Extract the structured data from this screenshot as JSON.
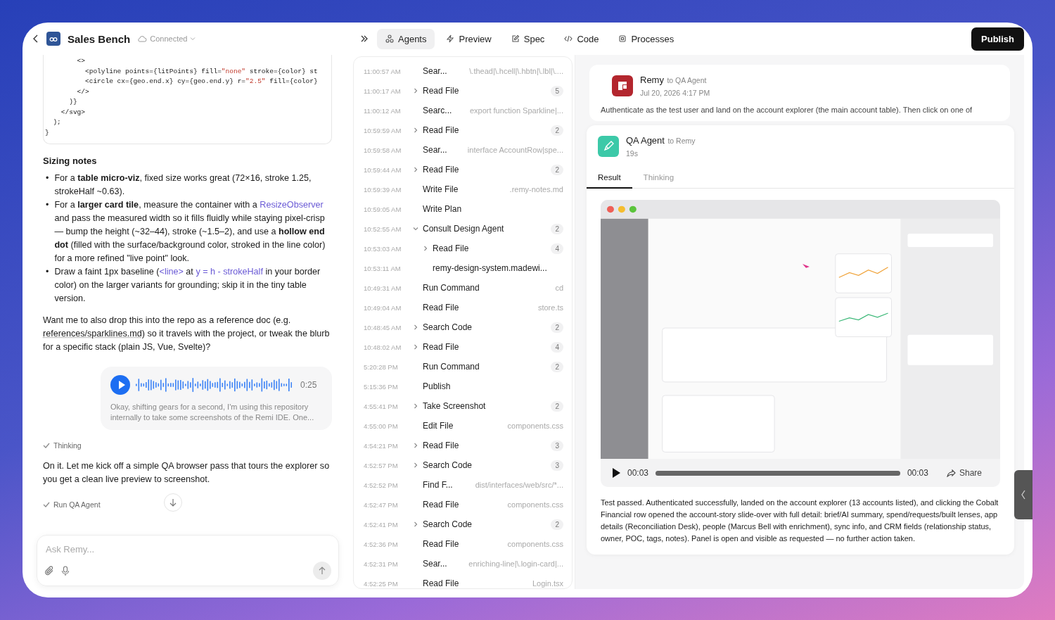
{
  "header": {
    "title": "Sales Bench",
    "status": "Connected"
  },
  "tabs": [
    {
      "label": "Agents",
      "kind": "agents",
      "selected": true
    },
    {
      "label": "Preview",
      "kind": "preview",
      "selected": false
    },
    {
      "label": "Spec",
      "kind": "spec",
      "selected": false
    },
    {
      "label": "Code",
      "kind": "code",
      "selected": false
    },
    {
      "label": "Processes",
      "kind": "processes",
      "selected": false
    }
  ],
  "publish_button": "Publish",
  "chat": {
    "code_lines": [
      [
        {
          "text": "        <>",
          "kind": "plain"
        }
      ],
      [
        {
          "text": "          <polyline points={litPoints} fill=",
          "kind": "plain"
        },
        {
          "text": "\"none\"",
          "kind": "string"
        },
        {
          "text": " stroke={color} st",
          "kind": "plain"
        }
      ],
      [
        {
          "text": "          <circle cx={geo.end.x} cy={geo.end.y} r=",
          "kind": "plain"
        },
        {
          "text": "\"2.5\"",
          "kind": "string"
        },
        {
          "text": " fill={color}",
          "kind": "plain"
        }
      ],
      [
        {
          "text": "        </>",
          "kind": "plain"
        }
      ],
      [
        {
          "text": "      )}",
          "kind": "plain"
        }
      ],
      [
        {
          "text": "    </svg>",
          "kind": "plain"
        }
      ],
      [
        {
          "text": "  );",
          "kind": "plain"
        }
      ],
      [
        {
          "text": "}",
          "kind": "plain"
        }
      ]
    ],
    "heading": "Sizing notes",
    "bullets": [
      {
        "marker": "•",
        "segments": [
          {
            "text": "For a ",
            "kind": "text"
          },
          {
            "text": "table micro-viz",
            "kind": "bold"
          },
          {
            "text": ", fixed size works great (72×16, stroke 1.25, strokeHalf ~0.63).",
            "kind": "text"
          }
        ]
      },
      {
        "marker": "•",
        "segments": [
          {
            "text": "For a ",
            "kind": "text"
          },
          {
            "text": "larger card tile",
            "kind": "bold"
          },
          {
            "text": ", measure the container with a ",
            "kind": "text"
          },
          {
            "text": "ResizeObserver",
            "kind": "code"
          },
          {
            "text": " and pass the measured width so it fills fluidly while staying pixel-crisp — bump the height (~32–44), stroke (~1.5–2), and use a ",
            "kind": "text"
          },
          {
            "text": "hollow end dot",
            "kind": "bold"
          },
          {
            "text": " (filled with the surface/background color, stroked in the line color) for a more refined \"live point\" look.",
            "kind": "text"
          }
        ]
      },
      {
        "marker": "•",
        "segments": [
          {
            "text": "Draw a faint 1px baseline (",
            "kind": "text"
          },
          {
            "text": "<line>",
            "kind": "code"
          },
          {
            "text": " at ",
            "kind": "text"
          },
          {
            "text": "y = h - strokeHalf",
            "kind": "code"
          },
          {
            "text": " in your border color) on the larger variants for grounding; skip it in the tiny table version.",
            "kind": "text"
          }
        ]
      }
    ],
    "question": [
      {
        "text": "Want me to also drop this into the repo as a reference doc (e.g. ",
        "kind": "text"
      },
      {
        "text": "references/sparklines.md",
        "kind": "link"
      },
      {
        "text": ") so it travels with the project, or tweak the blurb for a specific stack (plain JS, Vue, Svelte)?",
        "kind": "text"
      }
    ],
    "voice_note": {
      "duration": "0:25",
      "transcript": "Okay, shifting gears for a second, I'm using this repository internally to take some screenshots of the Remi IDE. One..."
    },
    "thinking_step": {
      "label": "Thinking",
      "done": true
    },
    "reply": "On it. Let me kick off a simple QA browser pass that tours the explorer so you get a clean live preview to screenshot.",
    "run_step": {
      "label": "Run QA Agent",
      "done": true
    },
    "composer": {
      "placeholder": "Ask Remy..."
    }
  },
  "activity": [
    {
      "time": "11:00:57 AM",
      "label": "Sear...",
      "detail": "\\.thead|\\.hcell|\\.hbtn|\\.lbl|\\....",
      "kind": "plain"
    },
    {
      "time": "11:00:17 AM",
      "label": "Read File",
      "count": "5",
      "kind": "expandable",
      "expanded": false
    },
    {
      "time": "11:00:12 AM",
      "label": "Searc...",
      "detail": "export function Sparkline|...",
      "kind": "plain"
    },
    {
      "time": "10:59:59 AM",
      "label": "Read File",
      "count": "2",
      "kind": "expandable",
      "expanded": false
    },
    {
      "time": "10:59:58 AM",
      "label": "Sear...",
      "detail": "interface AccountRow|spe...",
      "kind": "plain"
    },
    {
      "time": "10:59:44 AM",
      "label": "Read File",
      "count": "2",
      "kind": "expandable",
      "expanded": false
    },
    {
      "time": "10:59:39 AM",
      "label": "Write File",
      "detail": ".remy-notes.md",
      "kind": "plain"
    },
    {
      "time": "10:59:05 AM",
      "label": "Write Plan",
      "kind": "plain"
    },
    {
      "time": "10:52:55 AM",
      "label": "Consult Design Agent",
      "count": "2",
      "kind": "expandable",
      "expanded": true,
      "children": [
        {
          "time": "10:53:03 AM",
          "label": "Read File",
          "count": "4",
          "kind": "expandable",
          "expanded": false
        },
        {
          "time": "10:53:11 AM",
          "label": "remy-design-system.madewi...",
          "kind": "plain"
        }
      ]
    },
    {
      "time": "10:49:31 AM",
      "label": "Run Command",
      "detail": "cd",
      "kind": "plain"
    },
    {
      "time": "10:49:04 AM",
      "label": "Read File",
      "detail": "store.ts",
      "kind": "plain"
    },
    {
      "time": "10:48:45 AM",
      "label": "Search Code",
      "count": "2",
      "kind": "expandable",
      "expanded": false
    },
    {
      "time": "10:48:02 AM",
      "label": "Read File",
      "count": "4",
      "kind": "expandable",
      "expanded": false
    },
    {
      "time": "5:20:28 PM",
      "label": "Run Command",
      "count": "2",
      "kind": "plain"
    },
    {
      "time": "5:15:36 PM",
      "label": "Publish",
      "kind": "plain"
    },
    {
      "time": "4:55:41 PM",
      "label": "Take Screenshot",
      "count": "2",
      "kind": "expandable",
      "expanded": false
    },
    {
      "time": "4:55:00 PM",
      "label": "Edit File",
      "detail": "components.css",
      "kind": "plain"
    },
    {
      "time": "4:54:21 PM",
      "label": "Read File",
      "count": "3",
      "kind": "expandable",
      "expanded": false
    },
    {
      "time": "4:52:57 PM",
      "label": "Search Code",
      "count": "3",
      "kind": "expandable",
      "expanded": false
    },
    {
      "time": "4:52:52 PM",
      "label": "Find F...",
      "detail": "dist/interfaces/web/src/*...",
      "kind": "plain"
    },
    {
      "time": "4:52:47 PM",
      "label": "Read File",
      "detail": "components.css",
      "kind": "plain"
    },
    {
      "time": "4:52:41 PM",
      "label": "Search Code",
      "count": "2",
      "kind": "expandable",
      "expanded": false
    },
    {
      "time": "4:52:36 PM",
      "label": "Read File",
      "detail": "components.css",
      "kind": "plain"
    },
    {
      "time": "4:52:31 PM",
      "label": "Sear...",
      "detail": "enriching-line|\\.login-card|...",
      "kind": "plain"
    },
    {
      "time": "4:52:25 PM",
      "label": "Read File",
      "detail": "Login.tsx",
      "kind": "plain"
    }
  ],
  "messages": [
    {
      "sender": "Remy",
      "recipient": "to QA Agent",
      "meta": "Jul 20, 2026 4:17 PM",
      "kind": "remy",
      "text": "Authenticate as the test user and land on the account explorer (the main account table). Then click on one of"
    },
    {
      "sender": "QA Agent",
      "recipient": "to Remy",
      "meta": "19s",
      "kind": "qa",
      "tabs": [
        {
          "label": "Result",
          "selected": true
        },
        {
          "label": "Thinking",
          "selected": false
        }
      ],
      "video": {
        "kind": "picture",
        "elapsed": "00:03",
        "duration": "00:03",
        "level": 1,
        "share": "Share"
      },
      "text": "Test passed. Authenticated successfully, landed on the account explorer (13 accounts listed), and clicking the Cobalt Financial row opened the account-story slide-over with full detail: brief/AI summary, spend/requests/built lenses, app details (Reconciliation Desk), people (Marcus Bell with enrichment), sync info, and CRM fields (relationship status, owner, POC, tags, notes). Panel is open and visible as requested — no further action taken."
    }
  ]
}
